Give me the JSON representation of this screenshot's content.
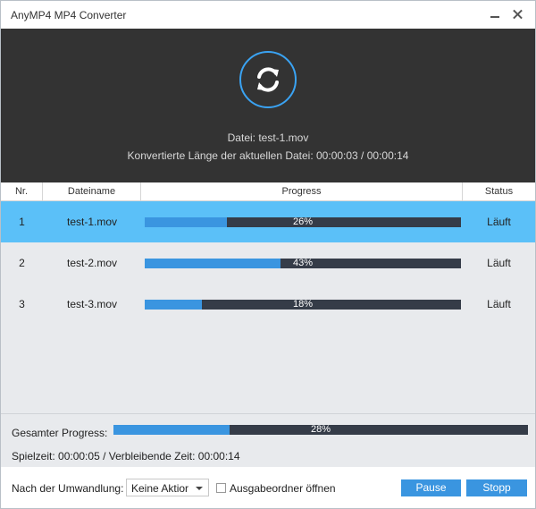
{
  "window": {
    "title": "AnyMP4 MP4 Converter"
  },
  "header": {
    "file_line": "Datei: test-1.mov",
    "length_line": "Konvertierte Länge der aktuellen Datei: 00:00:03 / 00:00:14",
    "icon": "convert-refresh-icon",
    "accent_color": "#3aa3f3"
  },
  "table": {
    "columns": [
      "Nr.",
      "Dateiname",
      "Progress",
      "Status"
    ],
    "rows": [
      {
        "nr": "1",
        "name": "test-1.mov",
        "progress": 26,
        "progress_label": "26%",
        "status": "Läuft",
        "selected": true
      },
      {
        "nr": "2",
        "name": "test-2.mov",
        "progress": 43,
        "progress_label": "43%",
        "status": "Läuft",
        "selected": false
      },
      {
        "nr": "3",
        "name": "test-3.mov",
        "progress": 18,
        "progress_label": "18%",
        "status": "Läuft",
        "selected": false
      }
    ]
  },
  "total": {
    "label": "Gesamter Progress:",
    "progress": 28,
    "progress_label": "28%",
    "time_line": "Spielzeit: 00:00:05 / Verbleibende Zeit: 00:00:14"
  },
  "footer": {
    "after_label": "Nach der Umwandlung:",
    "after_select": "Keine Aktior",
    "open_folder_label": "Ausgabeordner öffnen",
    "open_folder_checked": false,
    "pause_label": "Pause",
    "stop_label": "Stopp"
  },
  "colors": {
    "selected_row": "#5bc0f8",
    "progress_fill": "#3a95e0",
    "progress_track": "#353c48",
    "button": "#3a95e0"
  }
}
